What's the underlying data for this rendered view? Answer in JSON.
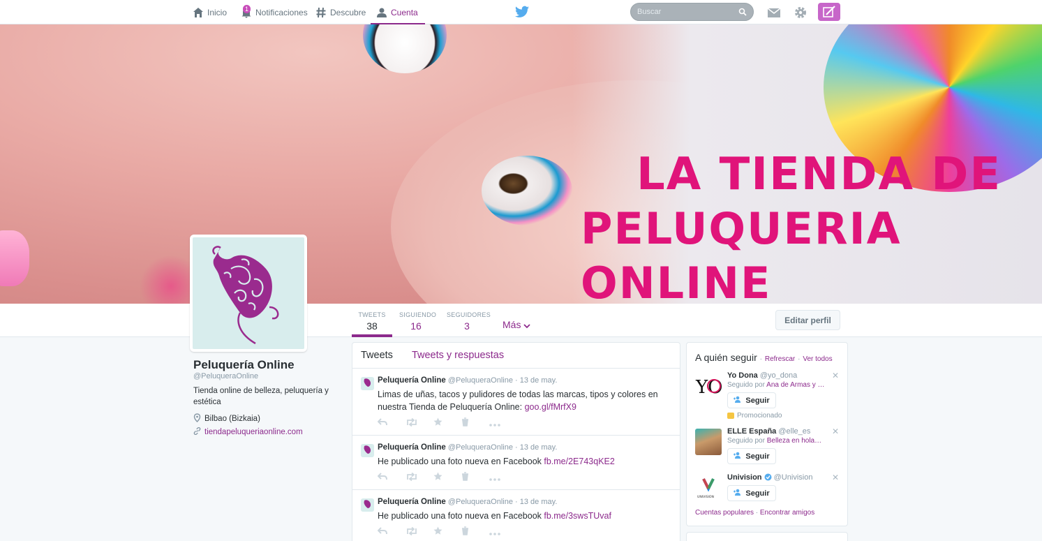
{
  "nav": {
    "home": "Inicio",
    "notifications": "Notificaciones",
    "notifications_count": "1",
    "discover": "Descubre",
    "account": "Cuenta",
    "search_placeholder": "Buscar"
  },
  "banner": {
    "title_line1": "LA TIENDA DE",
    "title_line2": "PELUQUERIA ONLINE"
  },
  "stats": [
    {
      "label": "TWEETS",
      "value": "38"
    },
    {
      "label": "SIGUIENDO",
      "value": "16"
    },
    {
      "label": "SEGUIDORES",
      "value": "3"
    }
  ],
  "more_label": "Más",
  "edit_profile": "Editar perfil",
  "profile": {
    "name": "Peluquería Online",
    "handle": "@PeluqueraOnline",
    "bio": "Tienda online de belleza, peluquería y estética",
    "location": "Bilbao (Bizkaia)",
    "url": "tiendapeluqueriaonline.com"
  },
  "timeline": {
    "tabs": [
      "Tweets",
      "Tweets y respuestas"
    ],
    "tweets": [
      {
        "name": "Peluquería Online",
        "handle": "@PeluqueraOnline",
        "sep": "·",
        "date": "13 de may.",
        "text": "Limas de uñas, tacos y pulidores de todas las marcas, tipos y colores en nuestra Tienda de Peluquería Online: ",
        "link": "goo.gl/fMrfX9"
      },
      {
        "name": "Peluquería Online",
        "handle": "@PeluqueraOnline",
        "sep": "·",
        "date": "13 de may.",
        "text": "He publicado una foto nueva en Facebook ",
        "link": "fb.me/2E743qKE2"
      },
      {
        "name": "Peluquería Online",
        "handle": "@PeluqueraOnline",
        "sep": "·",
        "date": "13 de may.",
        "text": "He publicado una foto nueva en Facebook ",
        "link": "fb.me/3swsTUvaf"
      }
    ]
  },
  "who_to_follow": {
    "title": "A quién seguir",
    "sep": "·",
    "refresh": "Refrescar",
    "view_all": "Ver todos",
    "follow_label": "Seguir",
    "followed_by": "Seguido por",
    "promoted": "Promocionado",
    "suggestions": [
      {
        "name": "Yo Dona",
        "handle": "@yo_dona",
        "by": "Ana de Armas y …",
        "avatar_text": "YO"
      },
      {
        "name": "ELLE España",
        "handle": "@elle_es",
        "by": "Belleza en hola…"
      },
      {
        "name": "Univision",
        "handle": "@Univision",
        "avatar_text": "UNIVISION"
      }
    ],
    "footer_popular": "Cuentas populares",
    "footer_friends": "Encontrar amigos"
  },
  "icons": {
    "home": "home-icon",
    "notifications": "bell-icon",
    "discover": "hashtag-icon",
    "account": "person-icon",
    "logo": "twitter-bird-icon",
    "search": "search-icon",
    "messages": "envelope-icon",
    "settings": "gear-icon",
    "compose": "compose-icon",
    "location": "location-pin-icon",
    "link": "link-icon",
    "verified": "verified-icon"
  },
  "colors": {
    "accent": "#8c2a8c",
    "compose": "#c766c9",
    "banner_text": "#e0147a"
  }
}
